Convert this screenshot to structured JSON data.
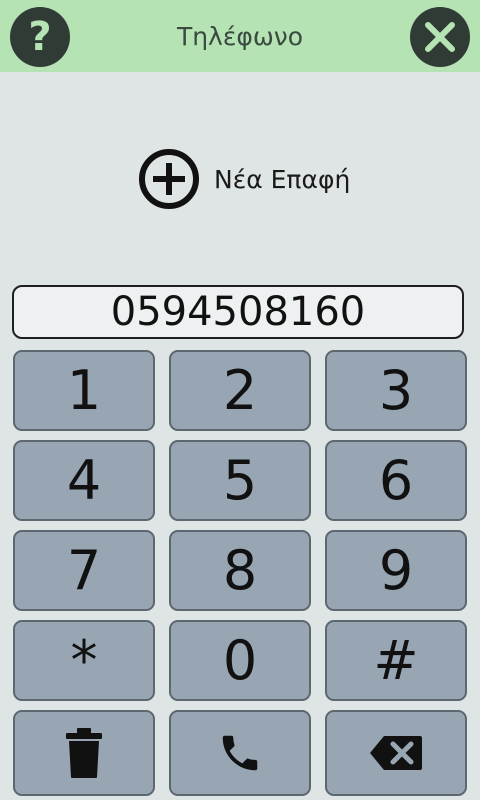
{
  "header": {
    "title": "Τηλέφωνο",
    "help_symbol": "?"
  },
  "new_contact": {
    "label": "Νέα Επαφή"
  },
  "dialer": {
    "number": "0594508160"
  },
  "keypad": {
    "k1": "1",
    "k2": "2",
    "k3": "3",
    "k4": "4",
    "k5": "5",
    "k6": "6",
    "k7": "7",
    "k8": "8",
    "k9": "9",
    "kstar": "*",
    "k0": "0",
    "khash": "#"
  },
  "icons": {
    "help": "question-mark-icon",
    "close": "close-icon",
    "add": "plus-circle-icon",
    "delete": "trash-icon",
    "call": "phone-icon",
    "backspace": "backspace-icon"
  },
  "colors": {
    "header_bg": "#b6e3b4",
    "page_bg": "#dfe4e4",
    "key_bg": "#98a6b3",
    "icon_dark": "#2f3b34"
  }
}
